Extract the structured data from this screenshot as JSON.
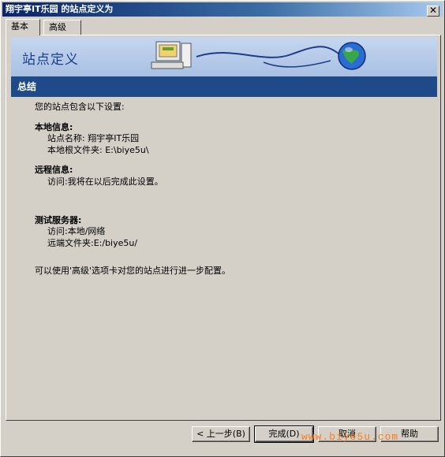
{
  "window": {
    "title": "翔宇亭IT乐园 的站点定义为",
    "close_glyph": "✕"
  },
  "tabs": [
    {
      "label": "基本",
      "active": true
    },
    {
      "label": "高级",
      "active": false
    }
  ],
  "banner": {
    "title": "站点定义"
  },
  "section": {
    "title": "总结"
  },
  "summary": {
    "intro": "您的站点包含以下设置:",
    "local_heading": "本地信息:",
    "local_name": "站点名称: 翔宇亭IT乐园",
    "local_root": "本地根文件夹: E:\\biye5u\\",
    "remote_heading": "远程信息:",
    "remote_access": "访问:我将在以后完成此设置。",
    "test_heading": "测试服务器:",
    "test_access": "访问:本地/网络",
    "test_folder": "远端文件夹:E:/biye5u/",
    "footer_note": "可以使用'高级'选项卡对您的站点进行进一步配置。"
  },
  "buttons": {
    "back": "< 上一步(B)",
    "finish": "完成(D)",
    "cancel": "取消",
    "help": "帮助"
  },
  "watermark": "www.biye5u.com"
}
